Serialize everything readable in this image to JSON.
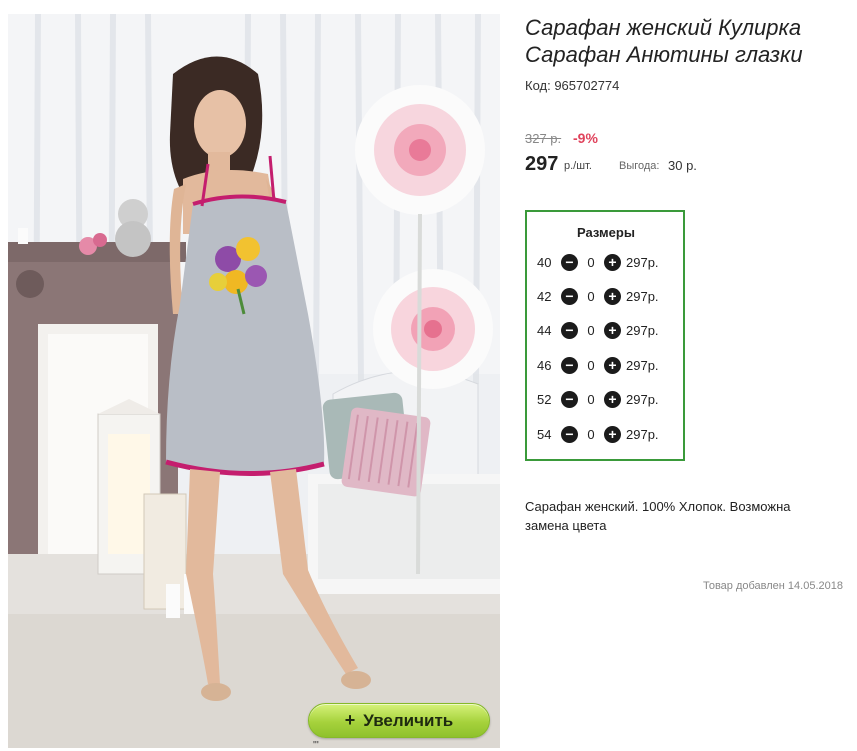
{
  "product": {
    "title_line1": "Сарафан женский Кулирка",
    "title_line2": "Сарафан Анютины глазки",
    "code": "Код: 965702774",
    "old_price": "327 р.",
    "discount": "-9%",
    "price": "297",
    "price_unit": "р./шт.",
    "benefit_label": "Выгода:",
    "benefit_value": "30 р.",
    "description": "Сарафан женский. 100% Хлопок. Возможна замена цвета",
    "added": "Товар добавлен 14.05.2018"
  },
  "sizes": {
    "title": "Размеры",
    "rows": [
      {
        "size": "40",
        "qty": "0",
        "price": "297р."
      },
      {
        "size": "42",
        "qty": "0",
        "price": "297р."
      },
      {
        "size": "44",
        "qty": "0",
        "price": "297р."
      },
      {
        "size": "46",
        "qty": "0",
        "price": "297р."
      },
      {
        "size": "52",
        "qty": "0",
        "price": "297р."
      },
      {
        "size": "54",
        "qty": "0",
        "price": "297р."
      }
    ]
  },
  "gallery": {
    "zoom_label": "Увеличить",
    "zoom_icon": "+",
    "bottom_mark": "'''"
  },
  "icons": {
    "minus": "−",
    "plus": "+"
  },
  "colors": {
    "sizes_border": "#3a9a3a",
    "discount": "#e0435c",
    "zoom_button": "#a6d23c"
  }
}
